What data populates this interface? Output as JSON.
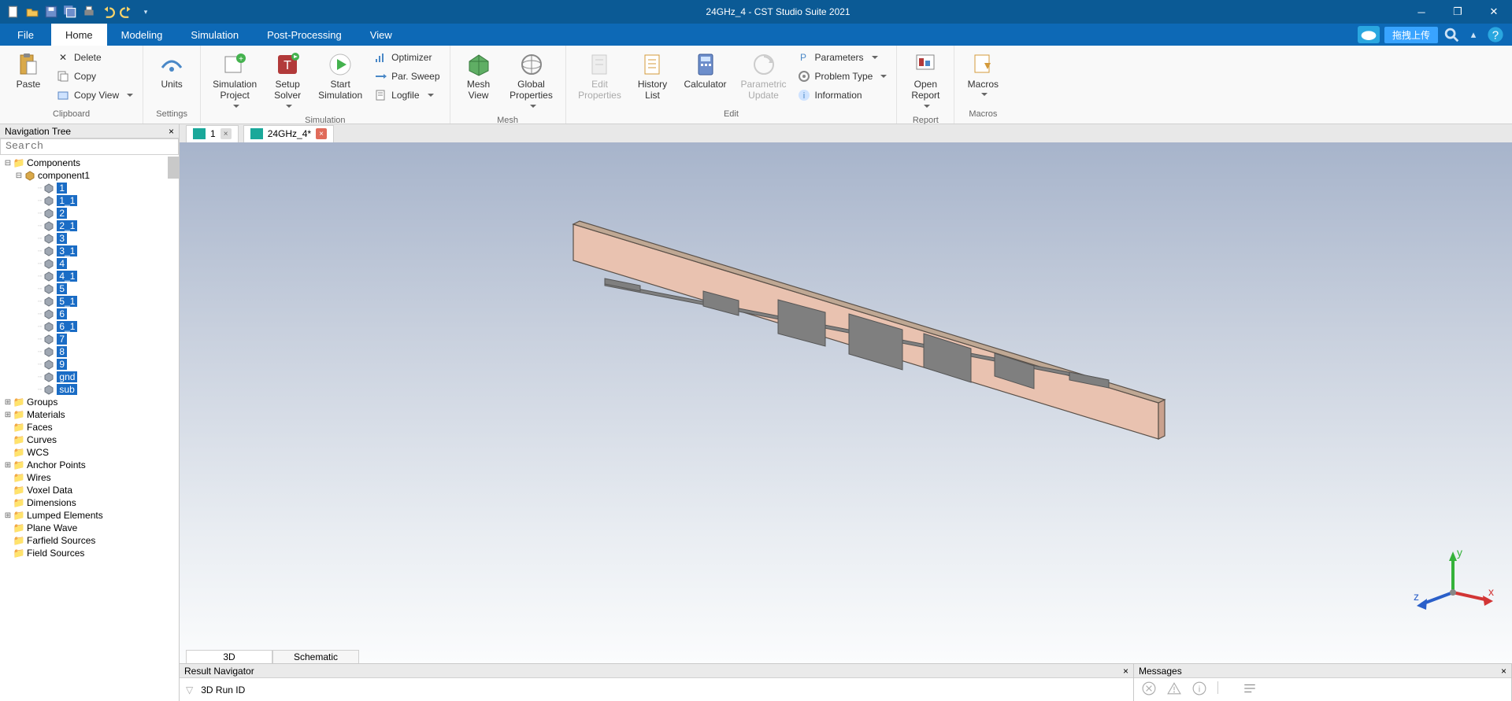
{
  "window": {
    "title": "24GHz_4 - CST Studio Suite 2021",
    "min_tooltip": "Minimize",
    "max_tooltip": "Restore",
    "close_tooltip": "Close"
  },
  "qat": [
    "new-file",
    "open-file",
    "save",
    "save-all",
    "print",
    "undo",
    "redo"
  ],
  "menubar": {
    "tabs": [
      "File",
      "Home",
      "Modeling",
      "Simulation",
      "Post-Processing",
      "View"
    ],
    "active": "Home",
    "upload_label": "拖拽上传"
  },
  "ribbon": {
    "clipboard": {
      "paste": "Paste",
      "delete": "Delete",
      "copy": "Copy",
      "copy_view": "Copy View",
      "group": "Clipboard"
    },
    "settings": {
      "units": "Units",
      "group": "Settings"
    },
    "simulation": {
      "sim_project": "Simulation\nProject",
      "setup_solver": "Setup\nSolver",
      "start_sim": "Start\nSimulation",
      "optimizer": "Optimizer",
      "par_sweep": "Par. Sweep",
      "logfile": "Logfile",
      "group": "Simulation"
    },
    "mesh": {
      "mesh_view": "Mesh\nView",
      "global_props": "Global\nProperties",
      "group": "Mesh"
    },
    "edit": {
      "edit_props": "Edit\nProperties",
      "history": "History\nList",
      "calculator": "Calculator",
      "param_update": "Parametric\nUpdate",
      "parameters": "Parameters",
      "problem_type": "Problem Type",
      "information": "Information",
      "group": "Edit"
    },
    "report": {
      "open_report": "Open\nReport",
      "group": "Report"
    },
    "macros": {
      "macros": "Macros",
      "group": "Macros"
    }
  },
  "nav": {
    "title": "Navigation Tree",
    "search_placeholder": "Search",
    "components": "Components",
    "component1": "component1",
    "items": [
      "1",
      "1_1",
      "2",
      "2_1",
      "3",
      "3_1",
      "4",
      "4_1",
      "5",
      "5_1",
      "6",
      "6_1",
      "7",
      "8",
      "9",
      "gnd",
      "sub"
    ],
    "other": [
      "Groups",
      "Materials",
      "Faces",
      "Curves",
      "WCS",
      "Anchor Points",
      "Wires",
      "Voxel Data",
      "Dimensions",
      "Lumped Elements",
      "Plane Wave",
      "Farfield Sources",
      "Field Sources"
    ]
  },
  "doctabs": {
    "tab1": "1",
    "tab2": "24GHz_4*"
  },
  "viewport": {
    "tab_3d": "3D",
    "tab_schematic": "Schematic",
    "axes": {
      "x": "x",
      "y": "y",
      "z": "z"
    }
  },
  "dock": {
    "resnav_title": "Result Navigator",
    "resnav_field": "3D Run ID",
    "msgs_title": "Messages"
  },
  "colors": {
    "brand": "#0d69b6",
    "substrate": "#e9c2b0",
    "metal": "#7f7f7f"
  }
}
